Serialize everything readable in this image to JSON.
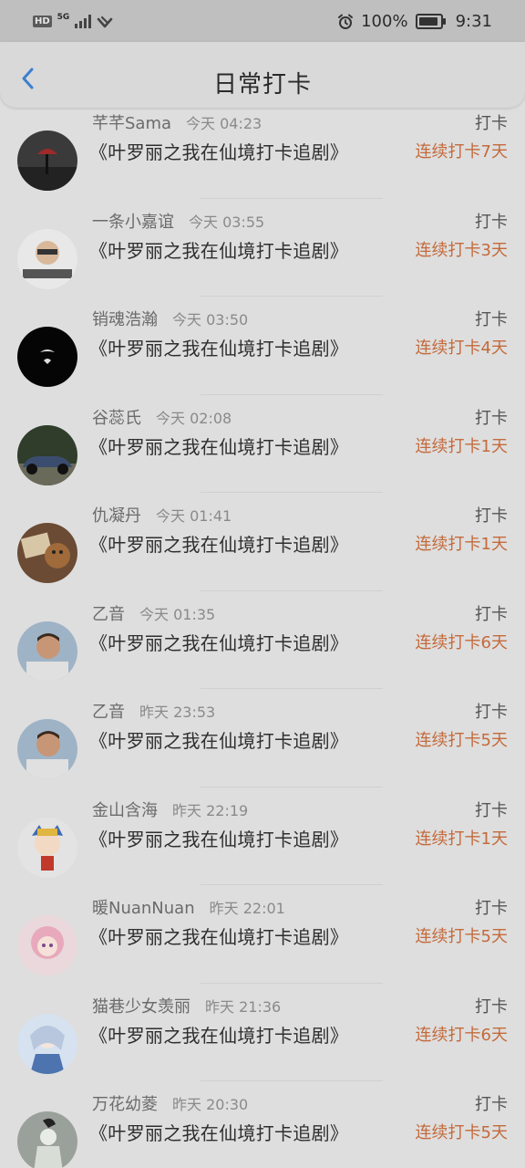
{
  "status_bar": {
    "hd": "HD",
    "network": "5G",
    "battery_percent": "100%",
    "battery_level": 1.0,
    "time": "9:31"
  },
  "header": {
    "title": "日常打卡",
    "back_icon": "chevron-left-icon",
    "accent_color": "#3b7fcf"
  },
  "colors": {
    "streak": "#c46a3b"
  },
  "feed": [
    {
      "name": "芊芊Sama",
      "time": "今天 04:23",
      "tag": "打卡",
      "title": "《叶罗丽之我在仙境打卡追剧》",
      "streak": "连续打卡7天"
    },
    {
      "name": "一条小嘉谊",
      "time": "今天 03:55",
      "tag": "打卡",
      "title": "《叶罗丽之我在仙境打卡追剧》",
      "streak": "连续打卡3天"
    },
    {
      "name": "销魂浩瀚",
      "time": "今天 03:50",
      "tag": "打卡",
      "title": "《叶罗丽之我在仙境打卡追剧》",
      "streak": "连续打卡4天"
    },
    {
      "name": "谷蕊氏",
      "time": "今天 02:08",
      "tag": "打卡",
      "title": "《叶罗丽之我在仙境打卡追剧》",
      "streak": "连续打卡1天"
    },
    {
      "name": "仇凝丹",
      "time": "今天 01:41",
      "tag": "打卡",
      "title": "《叶罗丽之我在仙境打卡追剧》",
      "streak": "连续打卡1天"
    },
    {
      "name": "乙音",
      "time": "今天 01:35",
      "tag": "打卡",
      "title": "《叶罗丽之我在仙境打卡追剧》",
      "streak": "连续打卡6天"
    },
    {
      "name": "乙音",
      "time": "昨天 23:53",
      "tag": "打卡",
      "title": "《叶罗丽之我在仙境打卡追剧》",
      "streak": "连续打卡5天"
    },
    {
      "name": "金山含海",
      "time": "昨天 22:19",
      "tag": "打卡",
      "title": "《叶罗丽之我在仙境打卡追剧》",
      "streak": "连续打卡1天"
    },
    {
      "name": "暖NuanNuan",
      "time": "昨天 22:01",
      "tag": "打卡",
      "title": "《叶罗丽之我在仙境打卡追剧》",
      "streak": "连续打卡5天"
    },
    {
      "name": "猫巷少女羡丽",
      "time": "昨天 21:36",
      "tag": "打卡",
      "title": "《叶罗丽之我在仙境打卡追剧》",
      "streak": "连续打卡6天"
    },
    {
      "name": "万花幼菱",
      "time": "昨天 20:30",
      "tag": "打卡",
      "title": "《叶罗丽之我在仙境打卡追剧》",
      "streak": "连续打卡5天"
    }
  ]
}
